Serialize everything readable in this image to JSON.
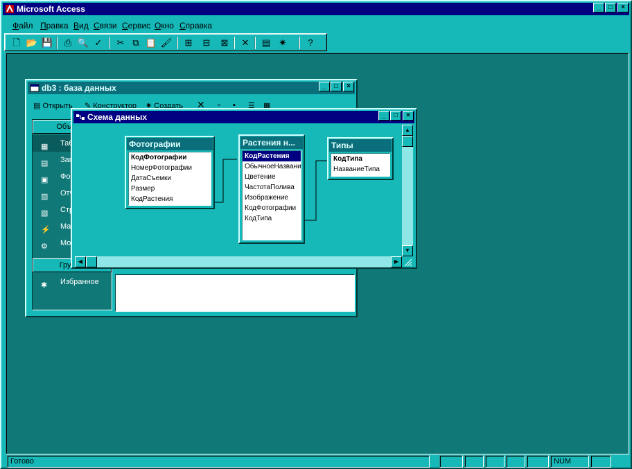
{
  "app": {
    "title": "Microsoft Access"
  },
  "menu": [
    {
      "label": "Файл",
      "key": "Ф",
      "rest": "айл"
    },
    {
      "label": "Правка",
      "key": "П",
      "rest": "равка"
    },
    {
      "label": "Вид",
      "key": "В",
      "rest": "ид"
    },
    {
      "label": "Связи",
      "key": "С",
      "rest": "вязи"
    },
    {
      "label": "Сервис",
      "key": "С",
      "rest": "ервис"
    },
    {
      "label": "Окно",
      "key": "О",
      "rest": "кно"
    },
    {
      "label": "Справка",
      "key": "С",
      "rest": "правка"
    }
  ],
  "toolbar_icons": [
    "new-icon",
    "open-icon",
    "save-icon",
    "print-icon",
    "print-preview-icon",
    "spelling-icon",
    "cut-icon",
    "copy-icon",
    "paste-icon",
    "format-painter-icon",
    "show-table-icon",
    "show-direct-icon",
    "show-all-icon",
    "delete-icon",
    "database-window-icon",
    "new-object-icon",
    "help-icon"
  ],
  "db_window": {
    "title": "db3 : база данных",
    "open": "Открыть",
    "design": "Конструктор",
    "create": "Создать",
    "objects_header": "Объекты",
    "objects": [
      "Таблицы",
      "Запросы",
      "Формы",
      "Отчеты",
      "Страницы",
      "Макросы",
      "Модули"
    ],
    "groups_header": "Группы",
    "favorites": "Избранное"
  },
  "rel_window": {
    "title": "Схема данных",
    "tables": [
      {
        "name": "Фотографии",
        "fields": [
          {
            "name": "КодФотографии",
            "pk": true
          },
          {
            "name": "НомерФотографии"
          },
          {
            "name": "ДатаСъемки"
          },
          {
            "name": "Размер"
          },
          {
            "name": "КодРастения"
          }
        ]
      },
      {
        "name": "Растения н...",
        "fields": [
          {
            "name": "КодРастения",
            "pk": true,
            "selected": true
          },
          {
            "name": "ОбычноеНазвание"
          },
          {
            "name": "Цветение"
          },
          {
            "name": "ЧастотаПолива"
          },
          {
            "name": "Изображение"
          },
          {
            "name": "КодФотографии"
          },
          {
            "name": "КодТипа"
          }
        ]
      },
      {
        "name": "Типы",
        "fields": [
          {
            "name": "КодТипа",
            "pk": true
          },
          {
            "name": "НазваниеТипа"
          }
        ]
      }
    ]
  },
  "status": {
    "text": "Готово",
    "num": "NUM"
  },
  "colors": {
    "desktop": "#117878",
    "face": "#16b8b8",
    "active_title": "#000080",
    "inactive_title": "#0a6f7a"
  }
}
